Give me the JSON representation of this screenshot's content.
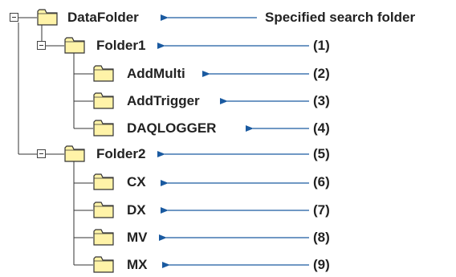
{
  "root": {
    "label": "DataFolder",
    "annotation": "Specified search folder"
  },
  "folders": [
    {
      "label": "Folder1",
      "annotation": "(1)",
      "children": [
        {
          "label": "AddMulti",
          "annotation": "(2)"
        },
        {
          "label": "AddTrigger",
          "annotation": "(3)"
        },
        {
          "label": "DAQLOGGER",
          "annotation": "(4)"
        }
      ]
    },
    {
      "label": "Folder2",
      "annotation": "(5)",
      "children": [
        {
          "label": "CX",
          "annotation": "(6)"
        },
        {
          "label": "DX",
          "annotation": "(7)"
        },
        {
          "label": "MV",
          "annotation": "(8)"
        },
        {
          "label": "MX",
          "annotation": "(9)"
        }
      ]
    }
  ],
  "colors": {
    "folder_fill": "#fff3a8",
    "folder_stroke": "#333333",
    "arrow": "#1a5aa0",
    "tree_line": "#333333"
  }
}
